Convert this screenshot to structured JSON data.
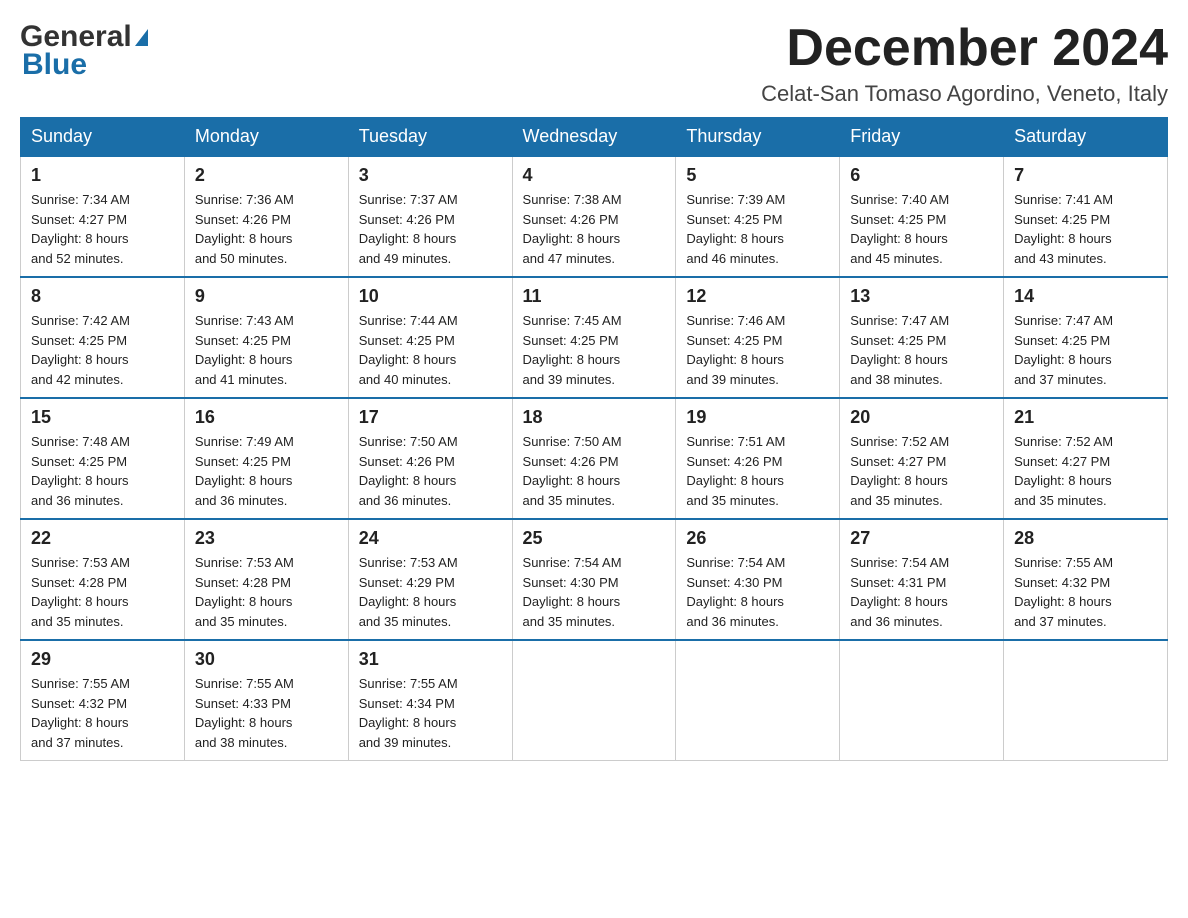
{
  "header": {
    "logo": {
      "line1": "General",
      "line2": "Blue"
    },
    "title": "December 2024",
    "location": "Celat-San Tomaso Agordino, Veneto, Italy"
  },
  "days_of_week": [
    "Sunday",
    "Monday",
    "Tuesday",
    "Wednesday",
    "Thursday",
    "Friday",
    "Saturday"
  ],
  "weeks": [
    [
      {
        "day": "1",
        "sunrise": "7:34 AM",
        "sunset": "4:27 PM",
        "daylight": "8 hours and 52 minutes."
      },
      {
        "day": "2",
        "sunrise": "7:36 AM",
        "sunset": "4:26 PM",
        "daylight": "8 hours and 50 minutes."
      },
      {
        "day": "3",
        "sunrise": "7:37 AM",
        "sunset": "4:26 PM",
        "daylight": "8 hours and 49 minutes."
      },
      {
        "day": "4",
        "sunrise": "7:38 AM",
        "sunset": "4:26 PM",
        "daylight": "8 hours and 47 minutes."
      },
      {
        "day": "5",
        "sunrise": "7:39 AM",
        "sunset": "4:25 PM",
        "daylight": "8 hours and 46 minutes."
      },
      {
        "day": "6",
        "sunrise": "7:40 AM",
        "sunset": "4:25 PM",
        "daylight": "8 hours and 45 minutes."
      },
      {
        "day": "7",
        "sunrise": "7:41 AM",
        "sunset": "4:25 PM",
        "daylight": "8 hours and 43 minutes."
      }
    ],
    [
      {
        "day": "8",
        "sunrise": "7:42 AM",
        "sunset": "4:25 PM",
        "daylight": "8 hours and 42 minutes."
      },
      {
        "day": "9",
        "sunrise": "7:43 AM",
        "sunset": "4:25 PM",
        "daylight": "8 hours and 41 minutes."
      },
      {
        "day": "10",
        "sunrise": "7:44 AM",
        "sunset": "4:25 PM",
        "daylight": "8 hours and 40 minutes."
      },
      {
        "day": "11",
        "sunrise": "7:45 AM",
        "sunset": "4:25 PM",
        "daylight": "8 hours and 39 minutes."
      },
      {
        "day": "12",
        "sunrise": "7:46 AM",
        "sunset": "4:25 PM",
        "daylight": "8 hours and 39 minutes."
      },
      {
        "day": "13",
        "sunrise": "7:47 AM",
        "sunset": "4:25 PM",
        "daylight": "8 hours and 38 minutes."
      },
      {
        "day": "14",
        "sunrise": "7:47 AM",
        "sunset": "4:25 PM",
        "daylight": "8 hours and 37 minutes."
      }
    ],
    [
      {
        "day": "15",
        "sunrise": "7:48 AM",
        "sunset": "4:25 PM",
        "daylight": "8 hours and 36 minutes."
      },
      {
        "day": "16",
        "sunrise": "7:49 AM",
        "sunset": "4:25 PM",
        "daylight": "8 hours and 36 minutes."
      },
      {
        "day": "17",
        "sunrise": "7:50 AM",
        "sunset": "4:26 PM",
        "daylight": "8 hours and 36 minutes."
      },
      {
        "day": "18",
        "sunrise": "7:50 AM",
        "sunset": "4:26 PM",
        "daylight": "8 hours and 35 minutes."
      },
      {
        "day": "19",
        "sunrise": "7:51 AM",
        "sunset": "4:26 PM",
        "daylight": "8 hours and 35 minutes."
      },
      {
        "day": "20",
        "sunrise": "7:52 AM",
        "sunset": "4:27 PM",
        "daylight": "8 hours and 35 minutes."
      },
      {
        "day": "21",
        "sunrise": "7:52 AM",
        "sunset": "4:27 PM",
        "daylight": "8 hours and 35 minutes."
      }
    ],
    [
      {
        "day": "22",
        "sunrise": "7:53 AM",
        "sunset": "4:28 PM",
        "daylight": "8 hours and 35 minutes."
      },
      {
        "day": "23",
        "sunrise": "7:53 AM",
        "sunset": "4:28 PM",
        "daylight": "8 hours and 35 minutes."
      },
      {
        "day": "24",
        "sunrise": "7:53 AM",
        "sunset": "4:29 PM",
        "daylight": "8 hours and 35 minutes."
      },
      {
        "day": "25",
        "sunrise": "7:54 AM",
        "sunset": "4:30 PM",
        "daylight": "8 hours and 35 minutes."
      },
      {
        "day": "26",
        "sunrise": "7:54 AM",
        "sunset": "4:30 PM",
        "daylight": "8 hours and 36 minutes."
      },
      {
        "day": "27",
        "sunrise": "7:54 AM",
        "sunset": "4:31 PM",
        "daylight": "8 hours and 36 minutes."
      },
      {
        "day": "28",
        "sunrise": "7:55 AM",
        "sunset": "4:32 PM",
        "daylight": "8 hours and 37 minutes."
      }
    ],
    [
      {
        "day": "29",
        "sunrise": "7:55 AM",
        "sunset": "4:32 PM",
        "daylight": "8 hours and 37 minutes."
      },
      {
        "day": "30",
        "sunrise": "7:55 AM",
        "sunset": "4:33 PM",
        "daylight": "8 hours and 38 minutes."
      },
      {
        "day": "31",
        "sunrise": "7:55 AM",
        "sunset": "4:34 PM",
        "daylight": "8 hours and 39 minutes."
      },
      null,
      null,
      null,
      null
    ]
  ],
  "labels": {
    "sunrise": "Sunrise:",
    "sunset": "Sunset:",
    "daylight": "Daylight:"
  }
}
